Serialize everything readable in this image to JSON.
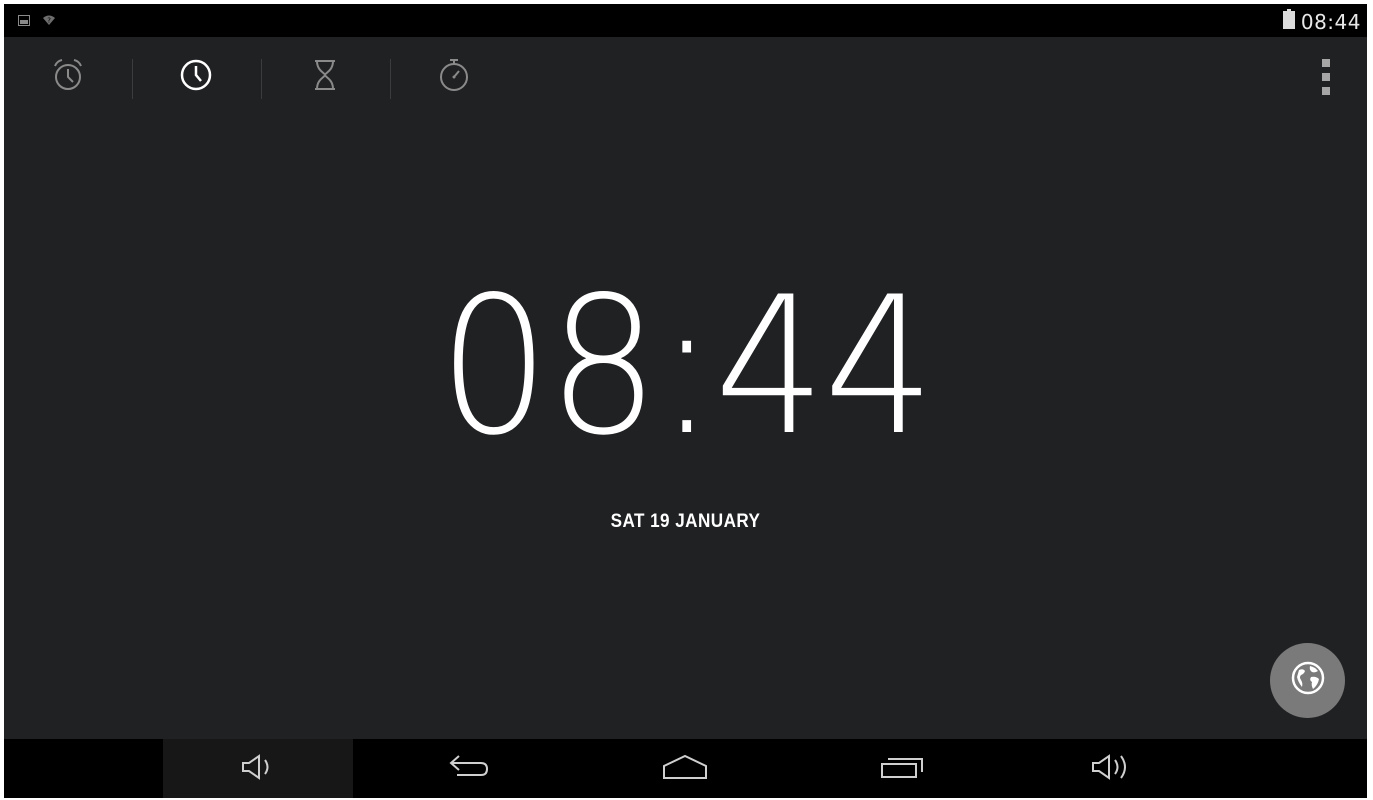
{
  "status_bar": {
    "time": "08:44",
    "icons": [
      "screenshot-notification-icon",
      "wifi-icon",
      "battery-icon"
    ]
  },
  "toolbar": {
    "tabs": [
      {
        "icon": "alarm-icon",
        "selected": false
      },
      {
        "icon": "clock-icon",
        "selected": true
      },
      {
        "icon": "timer-icon",
        "selected": false
      },
      {
        "icon": "stopwatch-icon",
        "selected": false
      }
    ],
    "menu_icon": "overflow-menu-icon"
  },
  "main": {
    "time": "08:44",
    "date": "SAT 19 JANUARY"
  },
  "fab": {
    "icon": "globe-icon"
  },
  "nav_bar": {
    "buttons": [
      "volume-down-icon",
      "back-icon",
      "home-icon",
      "recent-apps-icon",
      "volume-up-icon"
    ]
  },
  "colors": {
    "background": "#202123",
    "bars": "#000000",
    "fab": "#7a7a7a",
    "icon_inactive": "#8a8a8a",
    "icon_active": "#ffffff",
    "text": "#ffffff"
  }
}
